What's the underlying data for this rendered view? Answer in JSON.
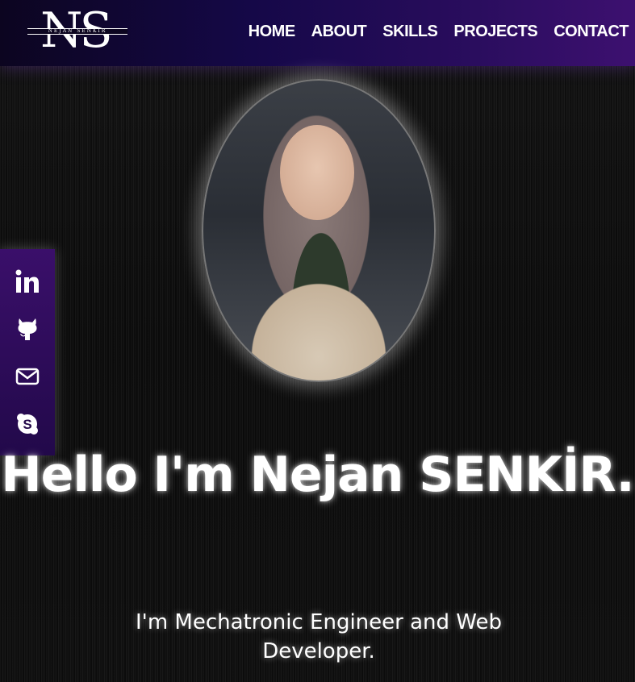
{
  "header": {
    "logo": {
      "letters": "NS",
      "band_text": "NEJAN SENKIR"
    },
    "nav": [
      {
        "label": "HOME"
      },
      {
        "label": "ABOUT"
      },
      {
        "label": "SKILLS"
      },
      {
        "label": "PROJECTS"
      },
      {
        "label": "CONTACT"
      }
    ]
  },
  "hero": {
    "portrait_alt": "profile photo",
    "greeting": "Hello I'm Nejan SENKİR.",
    "subtitle": "I'm Mechatronic Engineer and Web Developer."
  },
  "socials": [
    {
      "icon": "linkedin-icon"
    },
    {
      "icon": "github-icon"
    },
    {
      "icon": "mail-icon"
    },
    {
      "icon": "skype-icon"
    }
  ],
  "colors": {
    "nav_gradient_start": "#0c0520",
    "nav_gradient_end": "#3d1070",
    "social_panel": "#2d0c5a",
    "background": "#111111",
    "text": "#ffffff"
  }
}
